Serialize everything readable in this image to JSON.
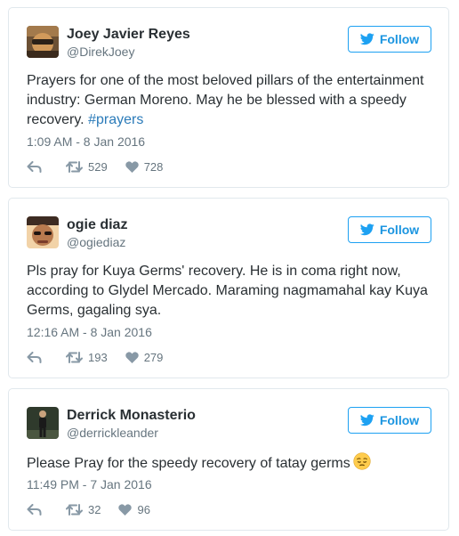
{
  "tweets": [
    {
      "name": "Joey Javier Reyes",
      "handle": "@DirekJoey",
      "follow_label": "Follow",
      "text": "Prayers for one of the most beloved pillars of the entertainment industry: German Moreno. May he be blessed with a speedy recovery. ",
      "hashtag": "#prayers",
      "time": "1:09 AM - 8 Jan 2016",
      "retweets": "529",
      "likes": "728"
    },
    {
      "name": "ogie diaz",
      "handle": "@ogiediaz",
      "follow_label": "Follow",
      "text": "Pls pray for Kuya Germs' recovery. He is in coma right now, according to Glydel Mercado. Maraming nagmamahal kay Kuya Germs, gagaling sya.",
      "time": "12:16 AM - 8 Jan 2016",
      "retweets": "193",
      "likes": "279"
    },
    {
      "name": "Derrick Monasterio",
      "handle": "@derrickleander",
      "follow_label": "Follow",
      "text": "Please Pray for the speedy recovery of tatay germs",
      "emoji": "pensive-face",
      "time": "11:49 PM - 7 Jan 2016",
      "retweets": "32",
      "likes": "96"
    }
  ],
  "colors": {
    "accent": "#1da1f2",
    "hashtag": "#2b7bb9",
    "border": "#e1e8ed",
    "muted": "#66757f",
    "icon": "#8899a6"
  },
  "icons": {
    "follow": "twitter-bird-icon",
    "reply": "reply-icon",
    "retweet": "retweet-icon",
    "like": "heart-icon"
  }
}
